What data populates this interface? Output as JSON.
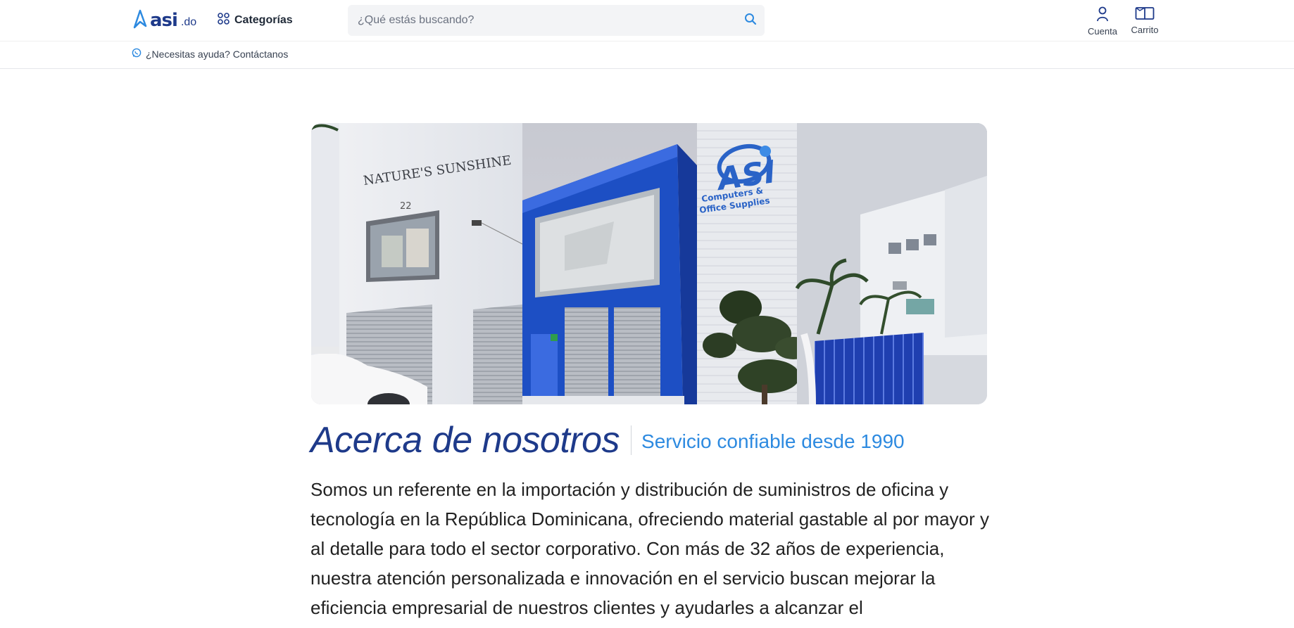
{
  "header": {
    "logo_main": "asi",
    "logo_suffix": ".do",
    "categories_label": "Categorías",
    "search_placeholder": "¿Qué estás buscando?",
    "account_label": "Cuenta",
    "cart_label": "Carrito"
  },
  "helpbar": {
    "text": "¿Necesitas ayuda? Contáctanos"
  },
  "hero": {
    "building_left_sign": "NATURE'S SUNSHINE",
    "building_number": "22",
    "store_logo": "ASI",
    "store_sign_line1": "Computers &",
    "store_sign_line2": "Office Supplies"
  },
  "about": {
    "title": "Acerca de nosotros",
    "subtitle": "Servicio confiable desde 1990",
    "body": "Somos un referente en la importación y distribución de suministros de oficina y tecnología en la República Dominicana, ofreciendo material gastable al por mayor y al detalle para todo el sector corporativo. Con más de 32 años de experiencia, nuestra atención personalizada e innovación en el servicio buscan mejorar la eficiencia empresarial de nuestros clientes y ayudarles a alcanzar el"
  },
  "colors": {
    "brand_navy": "#1e3a8a",
    "accent_blue": "#2d8ae0",
    "storefront_blue": "#1d4fc4"
  }
}
